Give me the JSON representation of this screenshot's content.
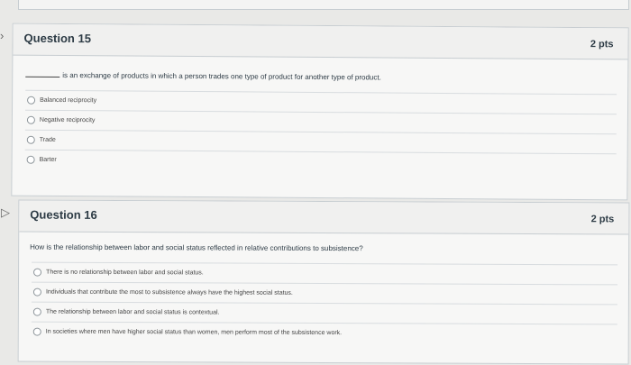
{
  "questions": [
    {
      "title": "Question 15",
      "points": "2 pts",
      "prompt": "is an exchange of products in which a person trades one type of product for another type of product.",
      "options": [
        "Balanced reciprocity",
        "Negative reciprocity",
        "Trade",
        "Barter"
      ]
    },
    {
      "title": "Question 16",
      "points": "2 pts",
      "prompt": "How is the relationship between labor and social status reflected in relative contributions to subsistence?",
      "options": [
        "There is no relationship between labor and social status.",
        "Individuals that contribute the most to subsistence always have the highest social status.",
        "The relationship between labor and social status is contextual.",
        "In societies where men have higher social status than women, men perform most of the subsistence work."
      ]
    }
  ],
  "icons": {
    "q15_flag": "bookmark-icon",
    "q16_flag": "flag-icon"
  }
}
